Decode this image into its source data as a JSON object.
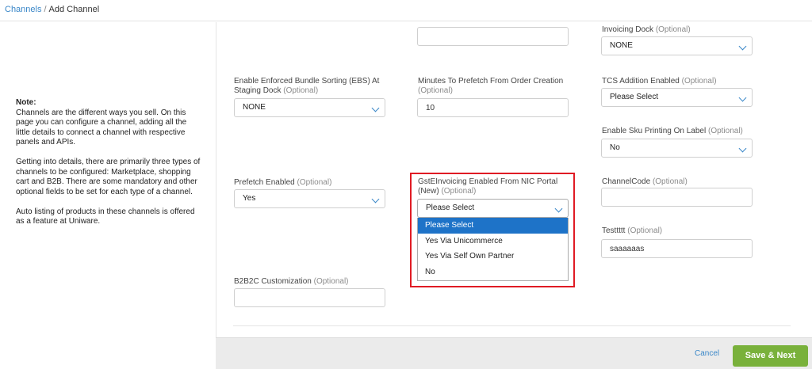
{
  "breadcrumb": {
    "root": "Channels",
    "separator": "/",
    "current": "Add Channel"
  },
  "note": {
    "title": "Note:",
    "paragraphs": [
      "Channels are the different ways you sell. On this page you can configure a channel, adding all the little details to connect a channel with respective panels and APIs.",
      "Getting into details, there are primarily three types of channels to be configured: Marketplace, shopping cart and B2B. There are some mandatory and other optional fields to be set for each type of a channel.",
      "Auto listing of products in these channels is offered as a feature at Uniware."
    ]
  },
  "optional": "(Optional)",
  "fields": {
    "invoicing_dock": {
      "label": "Invoicing Dock",
      "value": "NONE"
    },
    "ebs": {
      "label": "Enable Enforced Bundle Sorting (EBS) At Staging Dock",
      "value": "NONE"
    },
    "minutes_prefetch": {
      "label": "Minutes To Prefetch From Order Creation",
      "value": "10"
    },
    "tcs_addition": {
      "label": "TCS Addition Enabled",
      "value": "Please Select"
    },
    "sku_printing": {
      "label": "Enable Sku Printing On Label",
      "value": "No"
    },
    "prefetch_enabled": {
      "label": "Prefetch Enabled",
      "value": "Yes"
    },
    "gst_einvoicing": {
      "label": "GstEInvoicing Enabled From NIC Portal (New)",
      "value": "Please Select",
      "options": [
        "Please Select",
        "Yes Via Unicommerce",
        "Yes Via Self Own Partner",
        "No"
      ]
    },
    "channel_code": {
      "label": "ChannelCode",
      "value": ""
    },
    "testtttt": {
      "label": "Testtttt",
      "value": "saaaaaas"
    },
    "b2b2c": {
      "label": "B2B2C Customization",
      "value": ""
    }
  },
  "footer": {
    "cancel": "Cancel",
    "save": "Save & Next"
  },
  "colors": {
    "accent": "#3a87c8",
    "save": "#79b13b",
    "highlight": "#e01b24",
    "selected": "#1e73c8"
  }
}
